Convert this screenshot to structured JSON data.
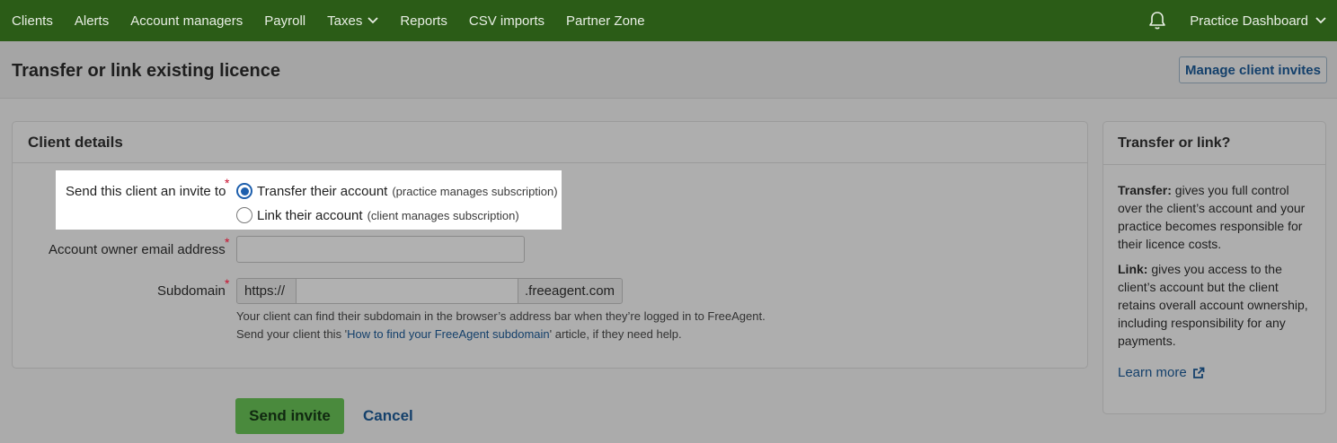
{
  "nav": {
    "items": [
      {
        "label": "Clients"
      },
      {
        "label": "Alerts"
      },
      {
        "label": "Account managers"
      },
      {
        "label": "Payroll"
      },
      {
        "label": "Taxes"
      },
      {
        "label": "Reports"
      },
      {
        "label": "CSV imports"
      },
      {
        "label": "Partner Zone"
      }
    ],
    "practice": "Practice Dashboard",
    "bell_icon": "bell-icon"
  },
  "page": {
    "title": "Transfer or link existing licence",
    "manage_invites": "Manage client invites"
  },
  "form": {
    "section_title": "Client details",
    "invite_label": "Send this client an invite to",
    "required_mark": "*",
    "options": [
      {
        "label": "Transfer their account",
        "hint": "(practice manages subscription)",
        "checked": true
      },
      {
        "label": "Link their account",
        "hint": "(client manages subscription)",
        "checked": false
      }
    ],
    "email_label": "Account owner email address",
    "email_value": "",
    "subdomain_label": "Subdomain",
    "subdomain_prefix": "https://",
    "subdomain_value": "",
    "subdomain_suffix": ".freeagent.com",
    "help_line1": "Your client can find their subdomain in the browser’s address bar when they’re logged in to FreeAgent.",
    "help_line2_pre": "Send your client this '",
    "help_line2_link": "How to find your FreeAgent subdomain",
    "help_line2_post": "' article, if they need help."
  },
  "actions": {
    "send": "Send invite",
    "cancel": "Cancel"
  },
  "sidebar": {
    "title": "Transfer or link?",
    "transfer_term": "Transfer:",
    "transfer_text": " gives you full control over the client’s account and your practice becomes responsible for their licence costs.",
    "link_term": "Link:",
    "link_text": " gives you access to the client’s account but the client retains overall account ownership, including responsibility for any payments.",
    "learn_more": "Learn more"
  },
  "colors": {
    "nav_bg": "#2b5c17",
    "primary_button": "#4a8a3d",
    "link": "#14406b",
    "required": "#c8102e"
  }
}
